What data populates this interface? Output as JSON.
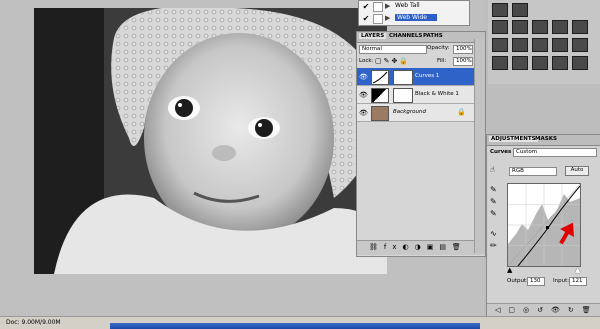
{
  "presets": {
    "items": [
      {
        "label": "Web Tall",
        "checked": true,
        "selected": false
      },
      {
        "label": "Web Wide",
        "checked": true,
        "selected": true
      }
    ]
  },
  "layers_panel": {
    "tabs": [
      "LAYERS",
      "CHANNELS",
      "PATHS"
    ],
    "blend_mode": "Normal",
    "opacity_label": "Opacity:",
    "opacity_value": "100%",
    "lock_label": "Lock:",
    "fill_label": "Fill:",
    "fill_value": "100%",
    "layers": [
      {
        "name": "Curves 1",
        "active": true
      },
      {
        "name": "Black & White 1",
        "active": false
      },
      {
        "name": "Background",
        "active": false
      }
    ]
  },
  "adjustments_panel": {
    "tabs": [
      "ADJUSTMENTS",
      "MASKS"
    ],
    "preset_label": "Curves",
    "preset_value": "Custom",
    "channel_value": "RGB",
    "auto_label": "Auto",
    "output_label": "Output:",
    "output_value": "130",
    "input_label": "Input:",
    "input_value": "121"
  },
  "status": {
    "doc_text": "Doc: 9.00M/9.00M"
  },
  "colors": {
    "selection_blue": "#2d5fc9",
    "arrow_red": "#e00000"
  }
}
